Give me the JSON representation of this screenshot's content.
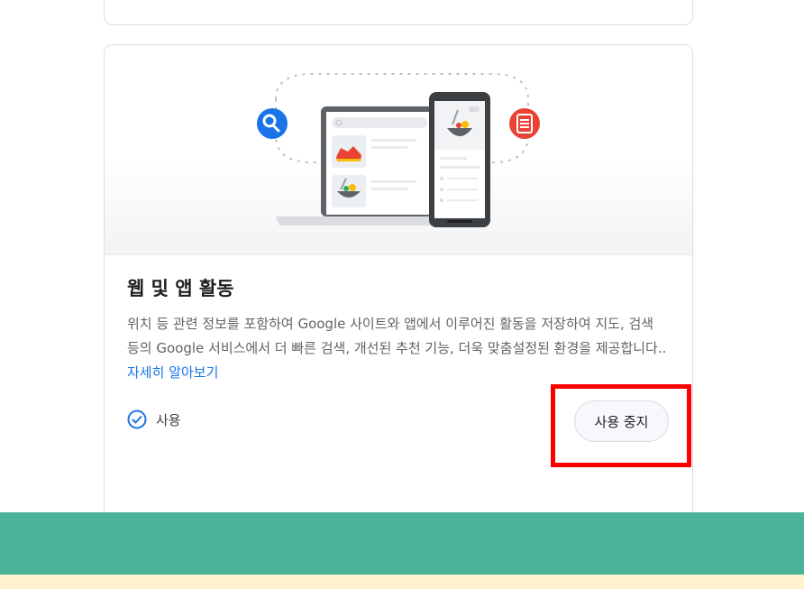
{
  "card": {
    "title": "웹 및 앱 활동",
    "description": "위치 등 관련 정보를 포함하여 Google 사이트와 앱에서 이루어진 활동을 저장하여 지도, 검색 등의 Google 서비스에서 더 빠른 검색, 개선된 추천 기능, 더욱 맞춤설정된 환경을 제공합니다.. ",
    "learn_more": "자세히 알아보기",
    "status_label": "사용",
    "pause_button": "사용 중지"
  },
  "icons": {
    "search": "search-icon",
    "document": "document-icon",
    "status": "check-circle-icon"
  },
  "colors": {
    "accent_blue": "#1a73e8",
    "red_icon": "#ea4335",
    "highlight": "#ff0000",
    "band_green": "#4bb399",
    "band_yellow": "#fff2cc"
  }
}
